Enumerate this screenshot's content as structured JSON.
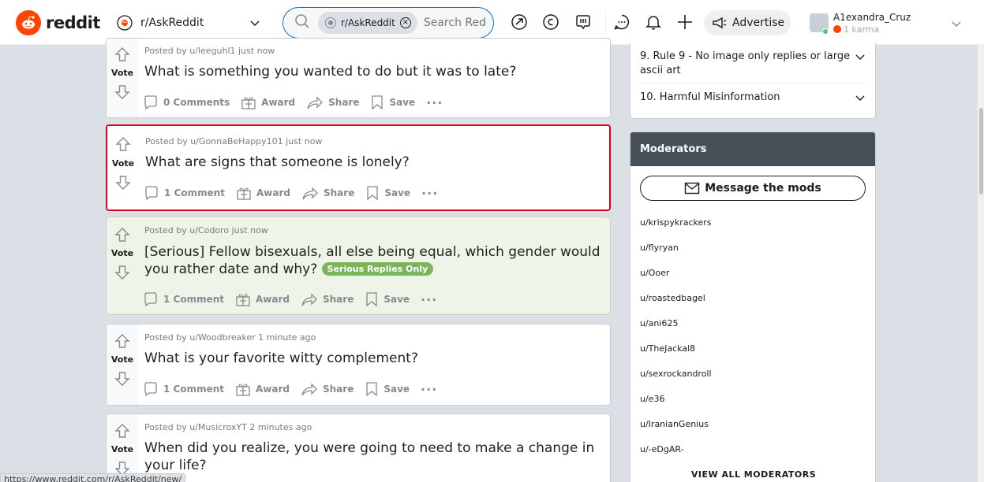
{
  "header": {
    "logo_text": "reddit",
    "community": "r/AskReddit",
    "search_chip": "r/AskReddit",
    "search_placeholder": "Search Reddit",
    "advertise_label": "Advertise",
    "username": "A1exandra_Cruz",
    "karma": "1 karma",
    "icons": [
      "popular-icon",
      "coins-icon",
      "rpan-icon",
      "chat-icon",
      "notification-icon",
      "create-post-icon",
      "megaphone-icon"
    ]
  },
  "posts": [
    {
      "meta": "Posted by u/leeguhl1 just now",
      "title": "What is something you wanted to do but it was to late?",
      "comments": "0 Comments"
    },
    {
      "meta": "Posted by u/GonnaBeHappy101 just now",
      "title": "What are signs that someone is lonely?",
      "comments": "1 Comment"
    },
    {
      "meta": "Posted by u/Codoro just now",
      "title": "[Serious] Fellow bisexuals, all else being equal, which gender would you rather date and why?",
      "flair": "Serious Replies Only",
      "comments": "1 Comment"
    },
    {
      "meta": "Posted by u/Woodbreaker 1 minute ago",
      "title": "What is your favorite witty complement?",
      "comments": "1 Comment"
    },
    {
      "meta": "Posted by u/MusicroxYT 2 minutes ago",
      "title": "When did you realize, you were going to need to make a change in your life?",
      "comments": ""
    }
  ],
  "post_actions": {
    "vote": "Vote",
    "award": "Award",
    "share": "Share",
    "save": "Save",
    "more": "···"
  },
  "rules": [
    {
      "text": "9. Rule 9 - No image only replies or large ascii art"
    },
    {
      "text": "10. Harmful Misinformation"
    }
  ],
  "moderators": {
    "title": "Moderators",
    "message_button": "Message the mods",
    "list": [
      "u/krispykrackers",
      "u/flyryan",
      "u/Ooer",
      "u/roastedbagel",
      "u/ani625",
      "u/TheJackal8",
      "u/sexrockandroll",
      "u/e36",
      "u/IranianGenius",
      "u/-eDgAR-"
    ],
    "view_all": "VIEW ALL MODERATORS"
  },
  "status_url": "https://www.reddit.com/r/AskReddit/new/",
  "colors": {
    "brand": "#ff4500",
    "search_border": "#0079d3",
    "selection": "#e0001a",
    "flair": "#7ab55c",
    "mods_header": "#474f58"
  }
}
